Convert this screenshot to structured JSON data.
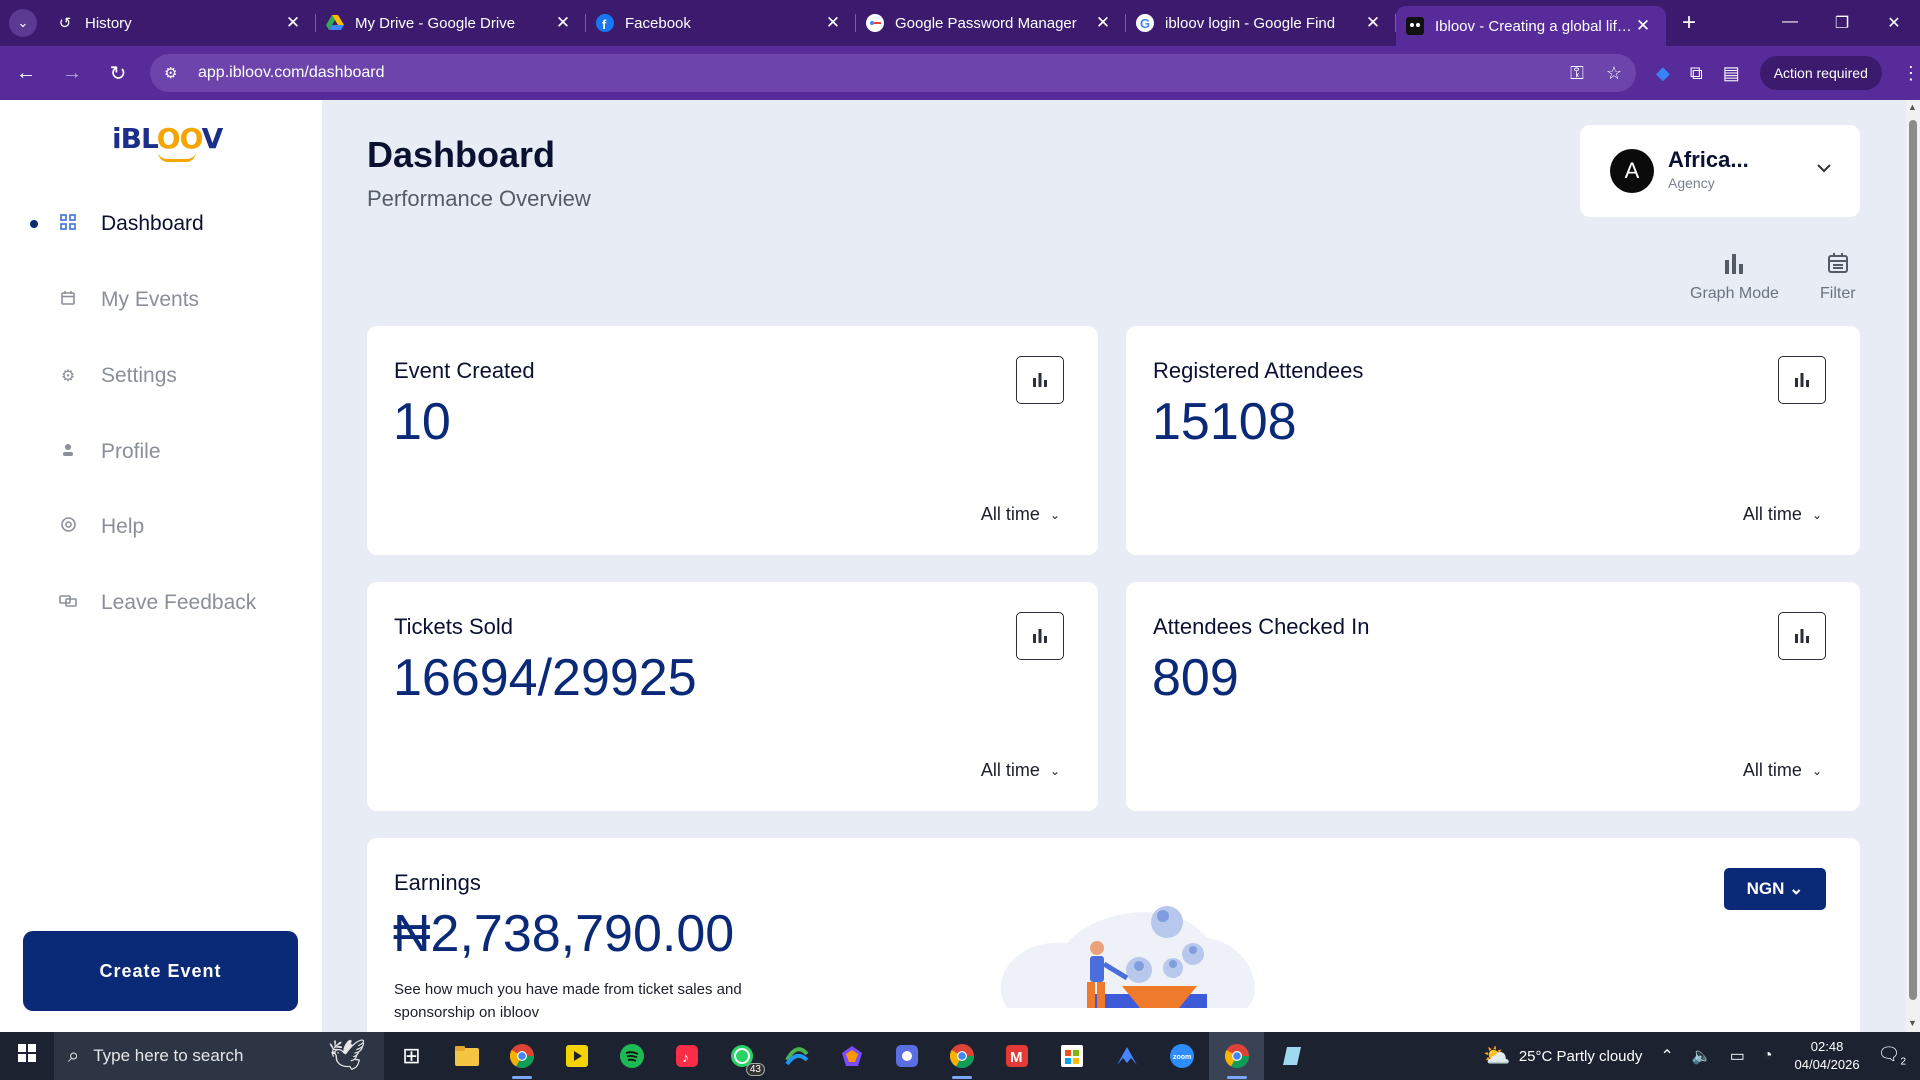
{
  "browser": {
    "tabs": [
      {
        "title": "History",
        "icon": "history-icon"
      },
      {
        "title": "My Drive - Google Drive",
        "icon": "google-drive-icon"
      },
      {
        "title": "Facebook",
        "icon": "facebook-icon"
      },
      {
        "title": "Google Password Manager",
        "icon": "password-manager-icon"
      },
      {
        "title": "ibloov login - Google Find",
        "icon": "google-icon"
      },
      {
        "title": "Ibloov - Creating a global lifestyle",
        "icon": "ibloov-icon",
        "active": true
      }
    ],
    "url": "app.ibloov.com/dashboard",
    "action_required": "Action required"
  },
  "sidebar": {
    "logo": {
      "part1": "iBL",
      "part2": "OO",
      "part3": "V"
    },
    "items": [
      {
        "label": "Dashboard",
        "icon": "grid-icon",
        "active": true
      },
      {
        "label": "My Events",
        "icon": "calendar-icon"
      },
      {
        "label": "Settings",
        "icon": "gear-icon"
      },
      {
        "label": "Profile",
        "icon": "person-icon"
      },
      {
        "label": "Help",
        "icon": "lifebuoy-icon"
      },
      {
        "label": "Leave Feedback",
        "icon": "feedback-icon"
      }
    ],
    "create_button": "Create Event"
  },
  "header": {
    "title": "Dashboard",
    "subtitle": "Performance Overview"
  },
  "account": {
    "avatar_letter": "A",
    "name": "Africa...",
    "role": "Agency"
  },
  "tools": {
    "graph_mode": "Graph Mode",
    "filter": "Filter"
  },
  "cards": [
    {
      "title": "Event Created",
      "value": "10",
      "range": "All time"
    },
    {
      "title": "Registered Attendees",
      "value": "15108",
      "range": "All time"
    },
    {
      "title": "Tickets Sold",
      "value": "16694/29925",
      "range": "All time"
    },
    {
      "title": "Attendees Checked In",
      "value": "809",
      "range": "All time"
    }
  ],
  "earnings": {
    "title": "Earnings",
    "value": "₦2,738,790.00",
    "description": "See how much you have made from ticket sales and sponsorship on ibloov",
    "currency": "NGN"
  },
  "taskbar": {
    "search_placeholder": "Type here to search",
    "whatsapp_badge": "43",
    "weather": "25°C  Partly cloudy",
    "time": "02:48",
    "date": "04/04/2026",
    "notification_count": "2"
  },
  "colors": {
    "brand_navy": "#0a2a78",
    "chrome_purple": "#572b9a",
    "logo_orange": "#f5a400"
  }
}
